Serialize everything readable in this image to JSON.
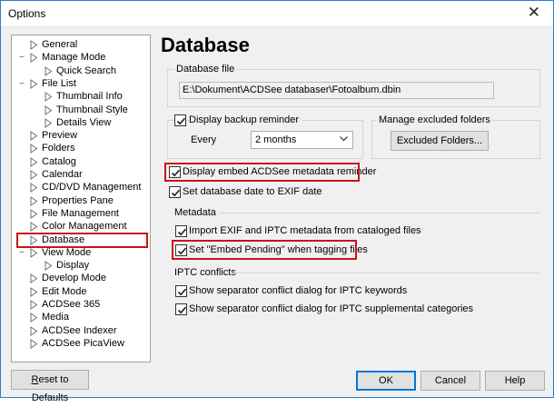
{
  "window": {
    "title": "Options",
    "close_glyph": "✕"
  },
  "tree": {
    "items": [
      {
        "label": "General"
      },
      {
        "label": "Manage Mode"
      },
      {
        "label": "Quick Search"
      },
      {
        "label": "File List"
      },
      {
        "label": "Thumbnail Info"
      },
      {
        "label": "Thumbnail Style"
      },
      {
        "label": "Details View"
      },
      {
        "label": "Preview"
      },
      {
        "label": "Folders"
      },
      {
        "label": "Catalog"
      },
      {
        "label": "Calendar"
      },
      {
        "label": "CD/DVD Management"
      },
      {
        "label": "Properties Pane"
      },
      {
        "label": "File Management"
      },
      {
        "label": "Color Management"
      },
      {
        "label": "Database"
      },
      {
        "label": "View Mode"
      },
      {
        "label": "Display"
      },
      {
        "label": "Develop Mode"
      },
      {
        "label": "Edit Mode"
      },
      {
        "label": "ACDSee 365"
      },
      {
        "label": "Media"
      },
      {
        "label": "ACDSee Indexer"
      },
      {
        "label": "ACDSee PicaView"
      }
    ],
    "selected": "Database",
    "expander_glyph": "−"
  },
  "page": {
    "heading": "Database",
    "database_file": {
      "label": "Database file",
      "path": "E:\\Dokument\\ACDSee databaser\\Fotoalbum.dbin"
    },
    "backup": {
      "label": "Display backup reminder",
      "checked": true,
      "every_label": "Every",
      "every_value": "2 months"
    },
    "excluded": {
      "label": "Manage excluded folders",
      "button": "Excluded Folders..."
    },
    "embed_reminder": {
      "label": "Display embed ACDSee metadata reminder",
      "checked": true
    },
    "exif_date": {
      "label": "Set database date to EXIF date",
      "checked": true
    },
    "metadata": {
      "label": "Metadata",
      "import": {
        "label": "Import EXIF and IPTC metadata from cataloged files",
        "checked": true
      },
      "embed_pending": {
        "label": "Set \"Embed Pending\" when tagging files",
        "checked": true
      }
    },
    "iptc": {
      "label": "IPTC conflicts",
      "keywords": {
        "label": "Show separator conflict dialog for IPTC keywords",
        "checked": true
      },
      "supplemental": {
        "label": "Show separator conflict dialog for IPTC supplemental categories",
        "checked": true
      }
    }
  },
  "footer": {
    "reset_prefix": "R",
    "reset_rest": "eset to Defaults",
    "ok": "OK",
    "cancel": "Cancel",
    "help": "Help"
  },
  "colors": {
    "highlight_red": "#c8151b",
    "accent_blue": "#0078d7"
  }
}
